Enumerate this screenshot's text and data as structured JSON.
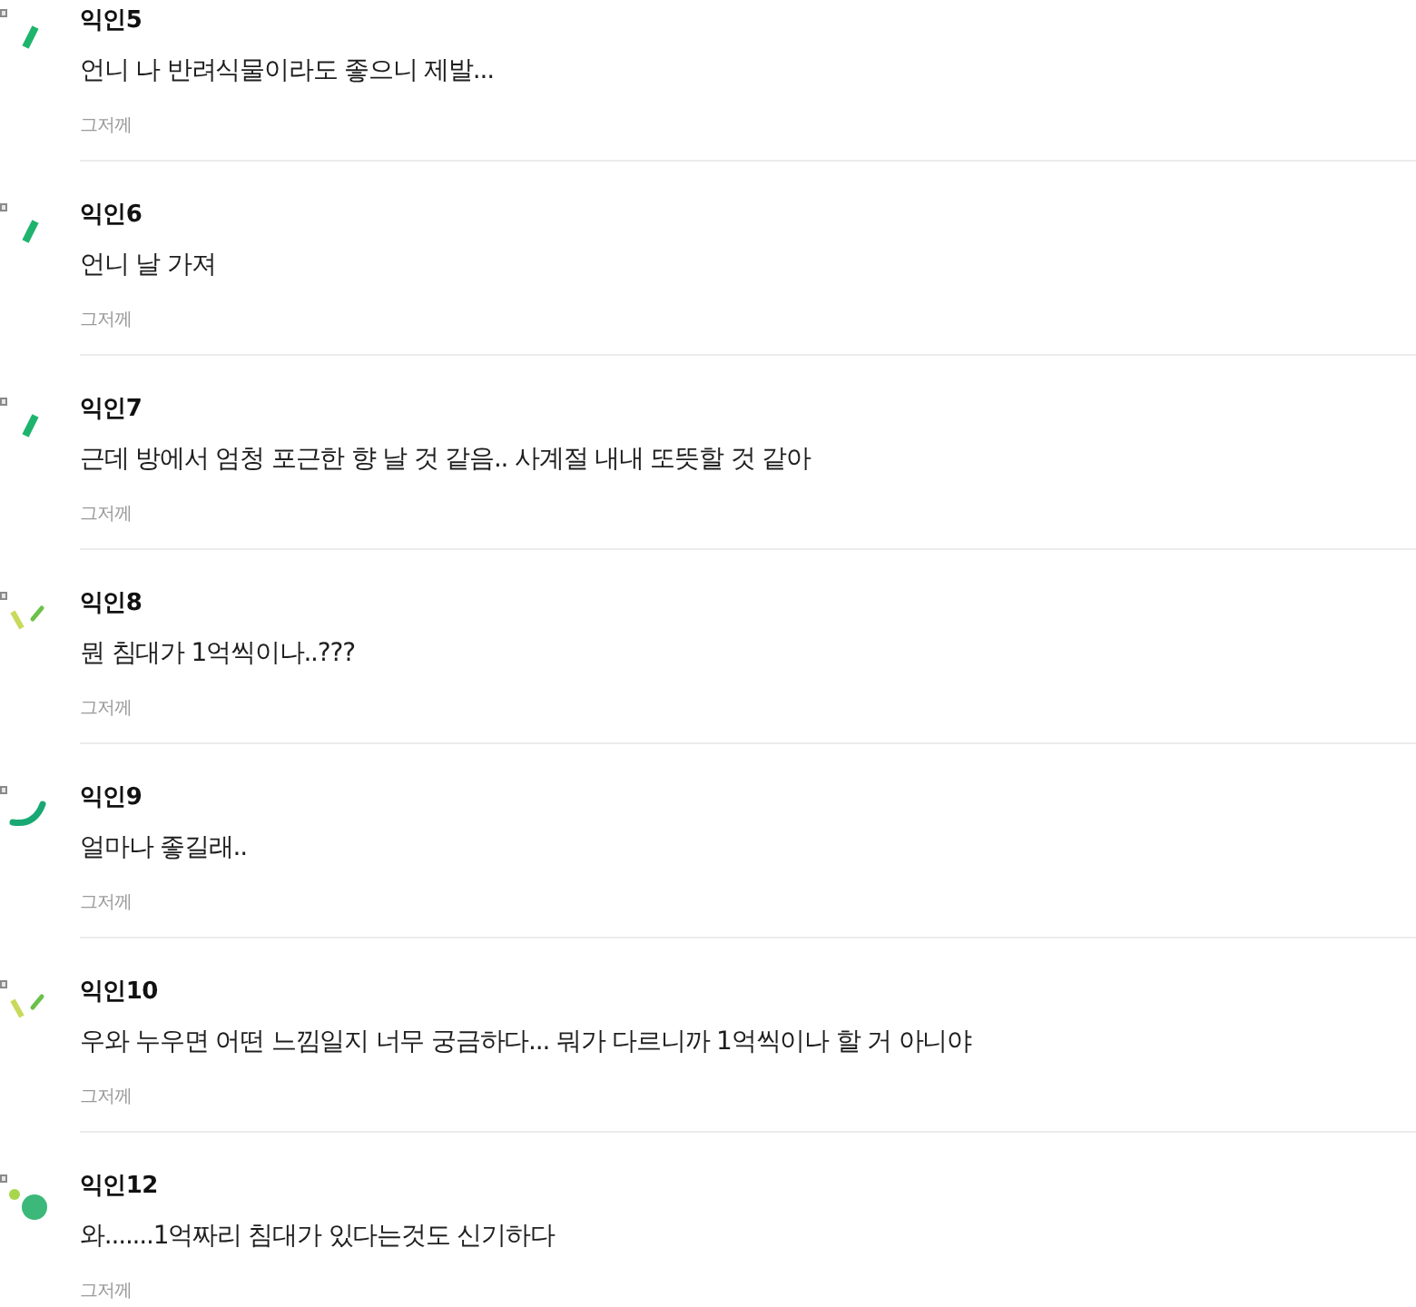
{
  "comments": [
    {
      "kind": "slash",
      "author": "익인5",
      "text": "언니 나 반려식물이라도 좋으니 제발...",
      "time": "그저께"
    },
    {
      "kind": "slash",
      "author": "익인6",
      "text": "언니 날 가져",
      "time": "그저께"
    },
    {
      "kind": "slash",
      "author": "익인7",
      "text": "근데 방에서 엄청 포근한 향 날 것 같음.. 사계절 내내 또뜻할 것 같아",
      "time": "그저께"
    },
    {
      "kind": "twin",
      "author": "익인8",
      "text": "뭔 침대가 1억씩이나..???",
      "time": "그저께"
    },
    {
      "kind": "arc",
      "author": "익인9",
      "text": "얼마나 좋길래..",
      "time": "그저께"
    },
    {
      "kind": "twin",
      "author": "익인10",
      "text": "우와 누우면 어떤 느낌일지 너무 궁금하다... 뭐가 다르니까 1억씩이나 할 거 아니야",
      "time": "그저께"
    },
    {
      "kind": "dots",
      "author": "익인12",
      "text": "와.......1억짜리 침대가 있다는것도 신기하다",
      "time": "그저께"
    }
  ]
}
